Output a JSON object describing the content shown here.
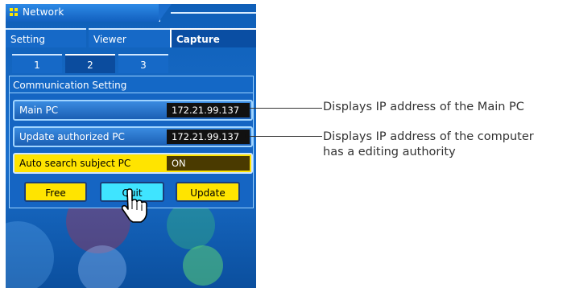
{
  "window": {
    "title": "Network"
  },
  "tabs": [
    {
      "label": "Setting",
      "active": false
    },
    {
      "label": "Viewer",
      "active": false
    },
    {
      "label": "Capture",
      "active": true
    }
  ],
  "subtabs": [
    {
      "label": "1",
      "active": false
    },
    {
      "label": "2",
      "active": true
    },
    {
      "label": "3",
      "active": false
    }
  ],
  "section": {
    "title": "Communication Setting",
    "rows": [
      {
        "label": "Main PC",
        "value": "172.21.99.137"
      },
      {
        "label": "Update authorized PC",
        "value": "172.21.99.137"
      },
      {
        "label": "Auto search subject PC",
        "value": "ON"
      }
    ]
  },
  "buttons": {
    "free": "Free",
    "quit": "Quit",
    "update": "Update"
  },
  "callouts": {
    "main_pc": "Displays IP address of the Main PC",
    "authorized_line1": "Displays IP address of the computer",
    "authorized_line2": "has a editing authority"
  },
  "colors": {
    "panel_blue": "#1669c7",
    "highlight_yellow": "#ffe400",
    "quit_cyan": "#3fe4ff"
  }
}
